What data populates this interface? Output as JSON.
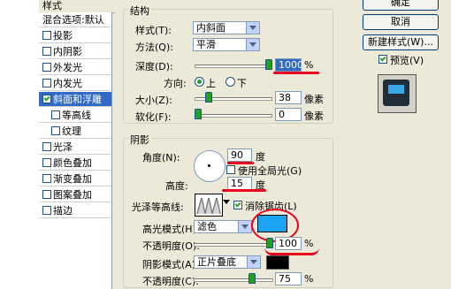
{
  "style_panel": {
    "header": "样式",
    "items": [
      {
        "label": "混合选项:默认",
        "checkbox": false,
        "checked": false,
        "selected": false,
        "sub": false
      },
      {
        "label": "投影",
        "checkbox": true,
        "checked": false,
        "selected": false,
        "sub": false
      },
      {
        "label": "内阴影",
        "checkbox": true,
        "checked": false,
        "selected": false,
        "sub": false
      },
      {
        "label": "外发光",
        "checkbox": true,
        "checked": false,
        "selected": false,
        "sub": false
      },
      {
        "label": "内发光",
        "checkbox": true,
        "checked": false,
        "selected": false,
        "sub": false
      },
      {
        "label": "斜面和浮雕",
        "checkbox": true,
        "checked": true,
        "selected": true,
        "sub": false
      },
      {
        "label": "等高线",
        "checkbox": true,
        "checked": false,
        "selected": false,
        "sub": true
      },
      {
        "label": "纹理",
        "checkbox": true,
        "checked": false,
        "selected": false,
        "sub": true
      },
      {
        "label": "光泽",
        "checkbox": true,
        "checked": false,
        "selected": false,
        "sub": false
      },
      {
        "label": "颜色叠加",
        "checkbox": true,
        "checked": false,
        "selected": false,
        "sub": false
      },
      {
        "label": "渐变叠加",
        "checkbox": true,
        "checked": false,
        "selected": false,
        "sub": false
      },
      {
        "label": "图案叠加",
        "checkbox": true,
        "checked": false,
        "selected": false,
        "sub": false
      },
      {
        "label": "描边",
        "checkbox": true,
        "checked": false,
        "selected": false,
        "sub": false
      }
    ]
  },
  "structure": {
    "title": "斜面和浮雕",
    "legend": "结构",
    "style_label": "样式(T):",
    "style_value": "内斜面",
    "method_label": "方法(Q):",
    "method_value": "平滑",
    "depth_label": "深度(D):",
    "depth_value": "1000",
    "depth_unit": "%",
    "depth_level": 1.0,
    "direction_label": "方向:",
    "dir_up": "上",
    "dir_down": "下",
    "size_label": "大小(Z):",
    "size_value": "38",
    "size_unit": "像素",
    "size_level": 0.15,
    "soften_label": "软化(F):",
    "soften_value": "0",
    "soften_unit": "像素",
    "soften_level": 0.0
  },
  "shading": {
    "legend": "阴影",
    "angle_label": "角度(N):",
    "angle_value": "90",
    "angle_unit": "度",
    "global_light_label": "使用全局光(G)",
    "altitude_label": "高度:",
    "altitude_value": "15",
    "altitude_unit": "度",
    "gloss_label": "光泽等高线:",
    "anti_alias_label": "消除锯齿(L)",
    "highlight_label": "高光模式(H):",
    "highlight_mode": "滤色",
    "highlight_color": "#1aa3f0",
    "hl_opacity_label": "不透明度(O):",
    "hl_opacity_value": "100",
    "hl_opacity_unit": "%",
    "hl_opacity_level": 1.0,
    "shadow_label": "阴影模式(A):",
    "shadow_mode": "正片叠底",
    "shadow_color": "#000000",
    "sh_opacity_label": "不透明度(C):",
    "sh_opacity_value": "75",
    "sh_opacity_unit": "%",
    "sh_opacity_level": 0.75
  },
  "buttons": {
    "ok": "确定",
    "cancel": "取消",
    "new_style": "新建样式(W)...",
    "preview": "预览(V)"
  }
}
